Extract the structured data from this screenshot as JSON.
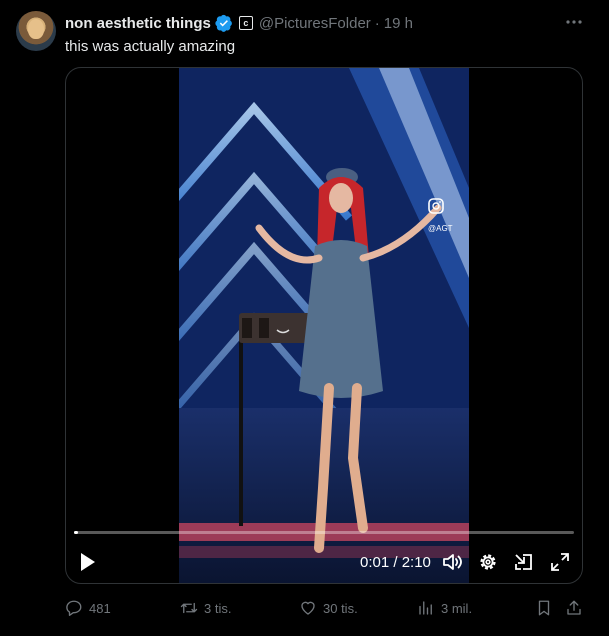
{
  "tweet": {
    "author_name": "non aesthetic things",
    "handle": "@PicturesFolder",
    "separator": "·",
    "time": "19 h",
    "text": "this was actually amazing",
    "badge_letter": "c"
  },
  "video": {
    "timecode": "0:01 / 2:10",
    "progress": 0.008,
    "watermark_handle": "@AGT"
  },
  "actions": {
    "replies": "481",
    "retweets": "3 tis.",
    "likes": "30 tis.",
    "views": "3 mil."
  },
  "colors": {
    "background": "#000000",
    "text_primary": "#e7e9ea",
    "text_secondary": "#71767b",
    "verified": "#1d9bf0",
    "border": "#2f3336"
  },
  "icons": [
    "more-icon",
    "verified-icon",
    "play-icon",
    "volume-icon",
    "settings-icon",
    "pip-icon",
    "fullscreen-icon",
    "reply-icon",
    "retweet-icon",
    "like-icon",
    "views-icon",
    "bookmark-icon",
    "share-icon"
  ]
}
